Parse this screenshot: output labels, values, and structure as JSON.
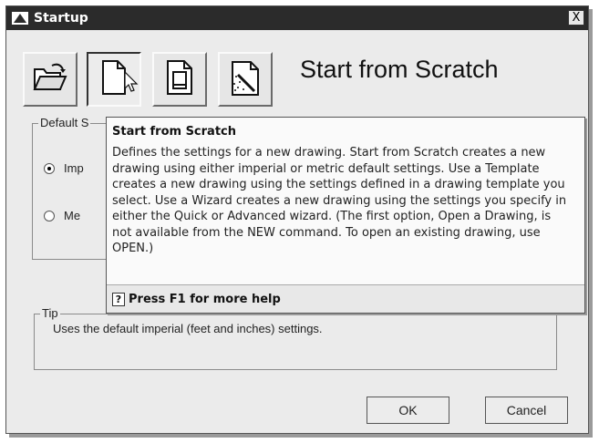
{
  "window": {
    "title": "Startup",
    "close_label": "X"
  },
  "toolbar": {
    "buttons": [
      {
        "name": "open-drawing",
        "icon": "folder-open-icon"
      },
      {
        "name": "start-from-scratch",
        "icon": "blank-page-icon",
        "active": true
      },
      {
        "name": "use-template",
        "icon": "template-page-icon"
      },
      {
        "name": "use-wizard",
        "icon": "wizard-icon"
      }
    ]
  },
  "mode_title": "Start from Scratch",
  "default_settings": {
    "label": "Default S",
    "options": [
      {
        "label": "Imp",
        "checked": true
      },
      {
        "label": "Me",
        "checked": false
      }
    ]
  },
  "tip": {
    "label": "Tip",
    "text": "Uses the default imperial (feet and inches) settings."
  },
  "tooltip": {
    "title": "Start from Scratch",
    "body": "Defines the settings for a new drawing. Start from Scratch creates a new drawing using either imperial or metric default settings. Use a Template creates a new drawing using the settings defined in a drawing template you select. Use a Wizard creates a new drawing using the settings you specify in either the Quick or Advanced wizard. (The first option, Open a Drawing, is not available from the NEW command. To open an existing drawing, use OPEN.)",
    "help_icon": "?",
    "help_text": "Press F1 for more help"
  },
  "buttons": {
    "ok": "OK",
    "cancel": "Cancel"
  }
}
